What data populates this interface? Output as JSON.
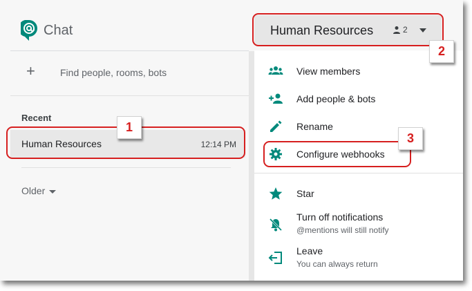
{
  "app": {
    "title": "Chat"
  },
  "left_panel": {
    "find_label": "Find people, rooms, bots",
    "recent_heading": "Recent",
    "conversations": [
      {
        "name": "Human Resources",
        "time": "12:14 PM"
      }
    ],
    "older_label": "Older"
  },
  "room": {
    "title": "Human Resources",
    "member_count": "2"
  },
  "menu": {
    "items": [
      {
        "label": "View members",
        "icon": "group-icon"
      },
      {
        "label": "Add people & bots",
        "icon": "person-add-icon"
      },
      {
        "label": "Rename",
        "icon": "pencil-icon"
      },
      {
        "label": "Configure webhooks",
        "icon": "gear-icon"
      },
      {
        "label": "Star",
        "icon": "star-icon"
      },
      {
        "label": "Turn off notifications",
        "sub": "@mentions will still notify",
        "icon": "notifications-off-icon"
      },
      {
        "label": "Leave",
        "sub": "You can always return",
        "icon": "leave-icon"
      }
    ]
  },
  "annotations": {
    "badges": [
      "1",
      "2",
      "3"
    ],
    "color": "#d61f1f"
  },
  "colors": {
    "accent": "#00897b",
    "callout": "#d61f1f"
  }
}
